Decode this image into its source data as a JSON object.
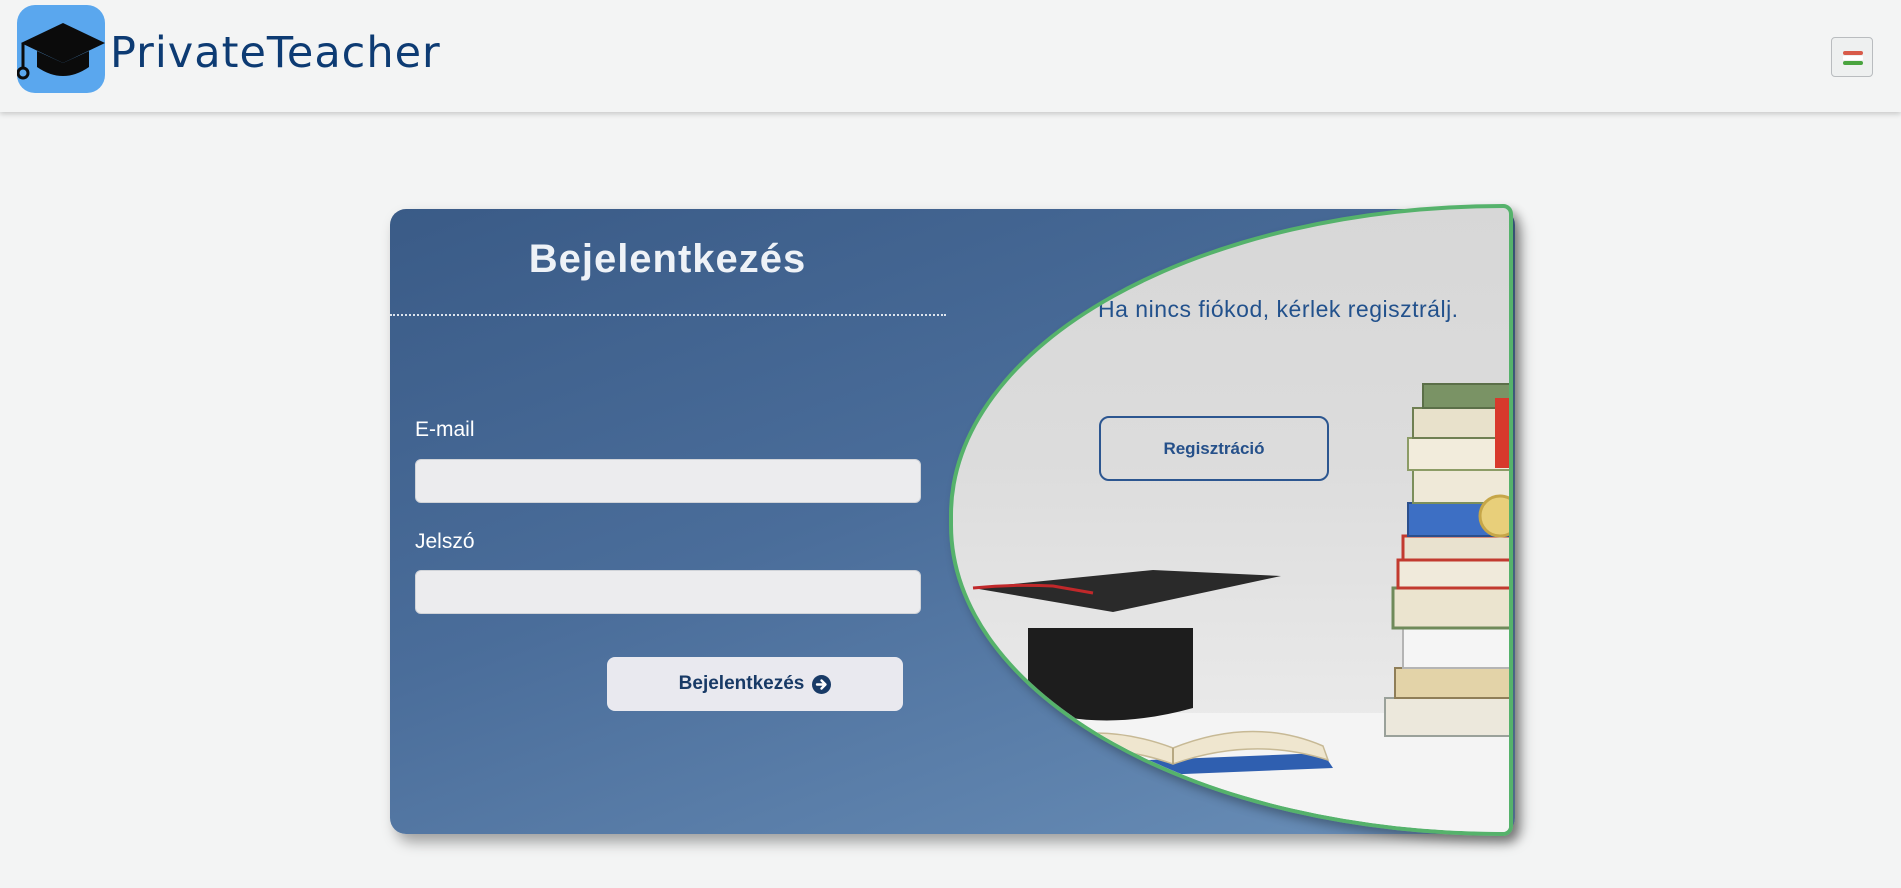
{
  "header": {
    "brand": "PrivateTeacher",
    "logo_icon": "graduation-cap-icon",
    "logo_bg": "#5aa7ee",
    "language_icon": "hungarian-flag-icon"
  },
  "login": {
    "title": "Bejelentkezés",
    "email_label": "E-mail",
    "email_value": "",
    "password_label": "Jelszó",
    "password_value": "",
    "submit_label": "Bejelentkezés",
    "submit_icon": "arrow-circle-right-icon"
  },
  "register": {
    "prompt": "Ha nincs fiókod, kérlek regisztrálj.",
    "button_label": "Regisztráció",
    "illustration": "graduation-cap-and-books-illustration"
  },
  "colors": {
    "brand": "#0d3b73",
    "card_start": "#3a5b87",
    "card_end": "#6a8fb8",
    "accent_border": "#55b26b"
  }
}
